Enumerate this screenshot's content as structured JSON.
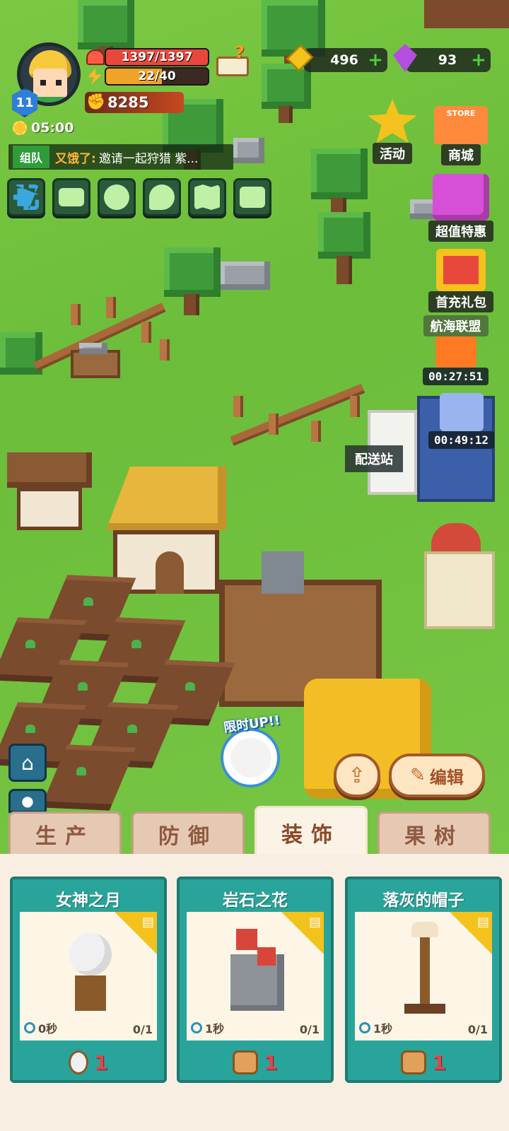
{
  "player": {
    "level": "11",
    "hp": "1397/1397",
    "hp_fraction": 1.0,
    "energy": "22/40",
    "energy_fraction": 0.55,
    "power": "8285",
    "time": "05:00"
  },
  "currency": {
    "gold": "496",
    "gems": "93"
  },
  "chat": {
    "tag": "组队",
    "sender": "又饿了:",
    "message": "邀请一起狩猎 紫..."
  },
  "quick_icons": [
    "fullscreen-icon",
    "mail-icon",
    "friends-icon",
    "chat-icon",
    "map-icon",
    "profile-card-icon"
  ],
  "side_buttons": {
    "activity": "活动",
    "store_badge": "STORE",
    "shop": "商城",
    "special_offer": "超值特惠",
    "first_recharge": "首充礼包",
    "alliance": "航海联盟",
    "timer1": "00:27:51",
    "timer2": "00:49:12"
  },
  "map": {
    "station": "配送站"
  },
  "promo": {
    "title": "限时UP!!"
  },
  "actions": {
    "edit": "编辑"
  },
  "tabs": [
    {
      "label": "生产",
      "active": false
    },
    {
      "label": "防御",
      "active": false
    },
    {
      "label": "装饰",
      "active": true
    },
    {
      "label": "果树",
      "active": false
    }
  ],
  "items": [
    {
      "name": "女神之月",
      "time": "0秒",
      "count": "0/1",
      "cost": "1"
    },
    {
      "name": "岩石之花",
      "time": "1秒",
      "count": "0/1",
      "cost": "1"
    },
    {
      "name": "落灰的帽子",
      "time": "1秒",
      "count": "0/1",
      "cost": "1"
    }
  ],
  "colors": {
    "grass": "#6fbf3a",
    "card": "#29a49a",
    "accent_red": "#e0464e",
    "tab_active": "#fbf3e6"
  }
}
